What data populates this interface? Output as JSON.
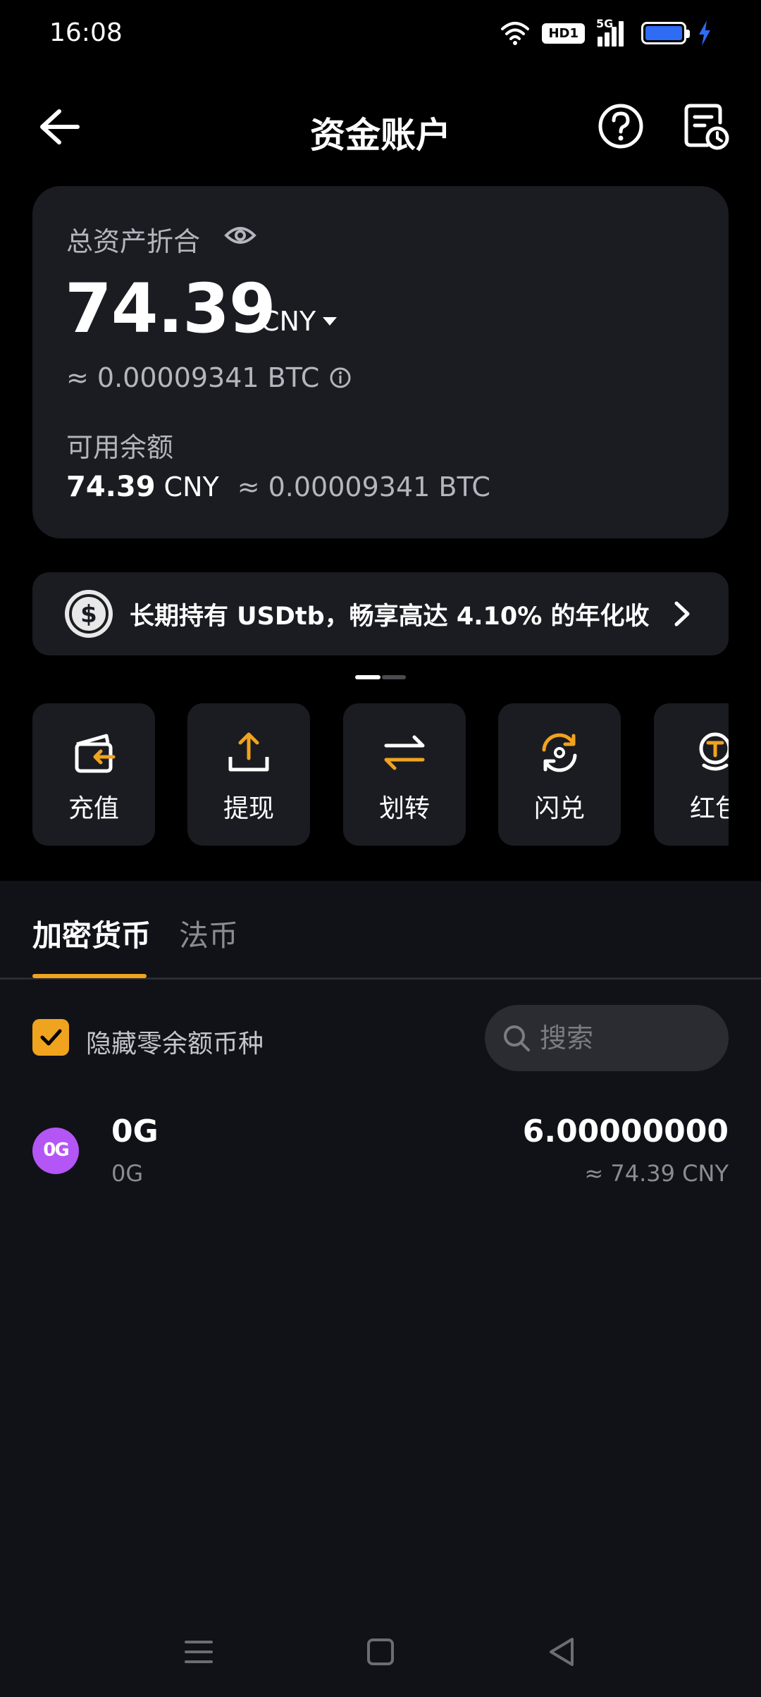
{
  "status_bar": {
    "time": "16:08",
    "hd_label": "HD1",
    "network": "5G"
  },
  "header": {
    "title": "资金账户"
  },
  "assets": {
    "total_label": "总资产折合",
    "total_value": "74.39",
    "currency": "CNY",
    "btc_equiv": "≈ 0.00009341 BTC",
    "available_label": "可用余额",
    "available_amount": "74.39",
    "available_currency": "CNY",
    "available_btc": "≈ 0.00009341 BTC"
  },
  "banner": {
    "text": "长期持有 USDtb，畅享高达 4.10% 的年化收",
    "pager": {
      "active_index": 0,
      "count": 2
    }
  },
  "actions": [
    {
      "label": "充值",
      "icon": "deposit-icon"
    },
    {
      "label": "提现",
      "icon": "withdraw-icon"
    },
    {
      "label": "划转",
      "icon": "transfer-icon"
    },
    {
      "label": "闪兑",
      "icon": "flash-convert-icon"
    },
    {
      "label": "红包",
      "icon": "red-packet-icon"
    }
  ],
  "tabs": {
    "crypto": "加密货币",
    "fiat": "法币",
    "active": "crypto"
  },
  "filter": {
    "hide_zero_label": "隐藏零余额币种",
    "hide_zero_checked": true,
    "search_placeholder": "搜索"
  },
  "asset_list": [
    {
      "symbol": "0G",
      "name": "0G",
      "logo_text": "0G",
      "amount": "6.00000000",
      "fiat_value": "≈ 74.39 CNY"
    }
  ],
  "colors": {
    "accent": "#f0a31e",
    "card": "#1b1c21",
    "background": "#000000",
    "list_background": "#111217",
    "battery": "#2e6cf5",
    "coin_logo": "#b455f5"
  }
}
